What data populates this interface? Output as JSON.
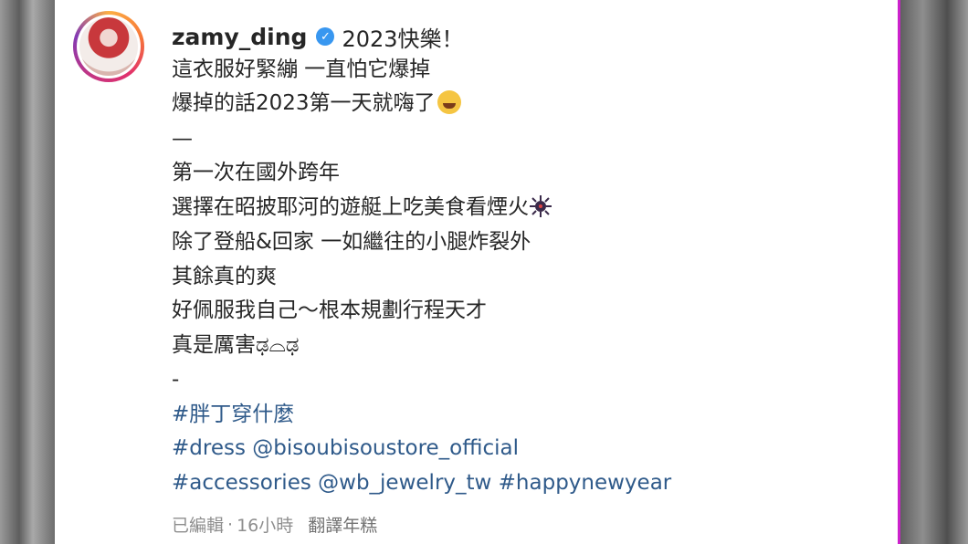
{
  "post": {
    "username": "zamy_ding",
    "verified_icon": "verified-badge-icon",
    "caption_first_line": "2023快樂！",
    "caption_lines": [
      "這衣服好緊繃 一直怕它爆掉",
      "爆掉的話2023第一天就嗨了",
      "—",
      "第一次在國外跨年",
      "選擇在昭披耶河的遊艇上吃美食看煙火",
      "除了登船&回家 一如繼往的小腿炸裂外",
      "其餘真的爽",
      "好佩服我自己～根本規劃行程天才",
      "真是厲害ಢ⌓ಢ",
      "-"
    ],
    "hashtag_line_1": "#胖丁穿什麼",
    "hashtag_line_2": "#dress @bisoubisoustore_official",
    "hashtag_line_3": "#accessories @wb_jewelry_tw #happynewyear",
    "footer": {
      "edited": "已編輯",
      "separator": "·",
      "time": "16小時",
      "translate": "翻譯年糕"
    },
    "colors": {
      "link": "#2f5a8a",
      "text": "#262626",
      "meta": "#8e8e8e",
      "verified": "#3897f0"
    }
  }
}
